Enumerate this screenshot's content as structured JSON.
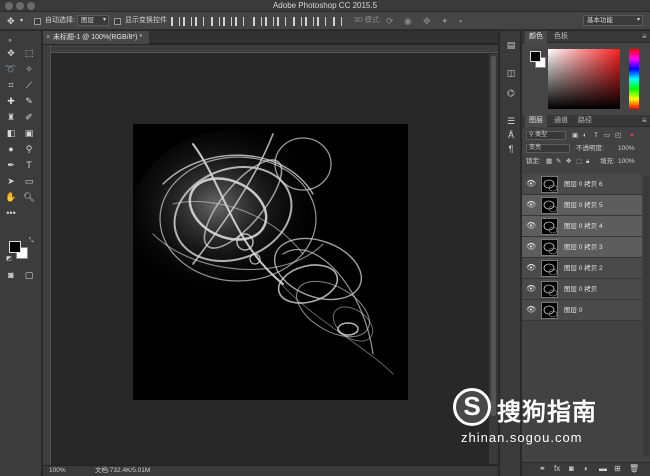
{
  "window": {
    "title": "Adobe Photoshop CC 2015.5"
  },
  "options_bar": {
    "auto_select_label": "自动选择:",
    "auto_select_value": "图层",
    "show_transform_label": "显示变换控件",
    "mode_3d_label": "3D 模式:",
    "workspace_value": "基本功能"
  },
  "document": {
    "tab_title": "未标题-1 @ 100%(RGB/8*) *",
    "zoom": "100%",
    "doc_info": "文档:732.4K/5.01M"
  },
  "color_panel": {
    "tabs": [
      "颜色",
      "色板"
    ]
  },
  "layers_panel": {
    "tabs": [
      "图层",
      "通道",
      "路径"
    ],
    "filter_label": "类型",
    "blend_mode": "变亮",
    "opacity_label": "不透明度:",
    "opacity_value": "100%",
    "lock_label": "锁定:",
    "fill_label": "填充:",
    "fill_value": "100%",
    "layers": [
      {
        "name": "图层 0 拷贝 6",
        "selected": false
      },
      {
        "name": "图层 0 拷贝 5",
        "selected": true
      },
      {
        "name": "图层 0 拷贝 4",
        "selected": true
      },
      {
        "name": "图层 0 拷贝 3",
        "selected": true
      },
      {
        "name": "图层 0 拷贝 2",
        "selected": false
      },
      {
        "name": "图层 0 拷贝",
        "selected": false
      },
      {
        "name": "图层 0",
        "selected": false
      }
    ],
    "bottom_icons": [
      "link-icon",
      "fx-icon",
      "mask-icon",
      "adjustment-icon",
      "group-icon",
      "new-layer-icon",
      "trash-icon"
    ]
  },
  "watermark": {
    "logo_letter": "S",
    "name": "搜狗指南",
    "url": "zhinan.sogou.com"
  }
}
